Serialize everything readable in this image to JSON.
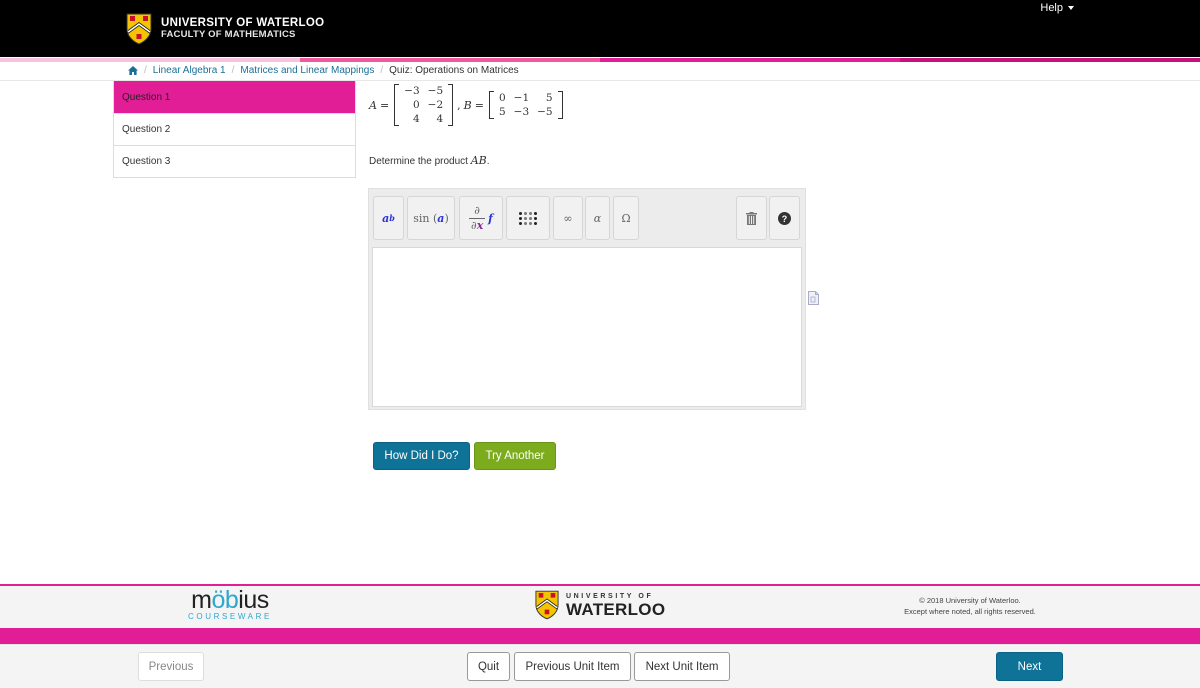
{
  "header": {
    "university": "UNIVERSITY OF WATERLOO",
    "faculty": "FACULTY OF MATHEMATICS",
    "help_label": "Help",
    "stripe_colors": [
      "#f9c3e0",
      "#f3589f",
      "#e21e97",
      "#c4127e"
    ]
  },
  "breadcrumb": {
    "home_icon": "home-icon",
    "items": [
      "Linear Algebra 1",
      "Matrices and Linear Mappings"
    ],
    "current": "Quiz: Operations on Matrices"
  },
  "sidebar": {
    "items": [
      {
        "label": "Question 1",
        "active": true
      },
      {
        "label": "Question 2",
        "active": false
      },
      {
        "label": "Question 3",
        "active": false
      }
    ]
  },
  "question": {
    "matrix_a_label": "A",
    "matrix_a": [
      [
        "−3",
        "−5"
      ],
      [
        "0",
        "−2"
      ],
      [
        "4",
        "4"
      ]
    ],
    "matrix_b_label": "B",
    "matrix_b": [
      [
        "0",
        "−1",
        "5"
      ],
      [
        "5",
        "−3",
        "−5"
      ]
    ],
    "equals": "=",
    "comma": ",",
    "prompt_text": "Determine the product ",
    "prompt_math": "AB",
    "prompt_end": "."
  },
  "editor": {
    "toolbar": {
      "power": {
        "base": "a",
        "exp": "b"
      },
      "sin": {
        "fn": "sin",
        "arg": "a"
      },
      "derivative": {
        "num": "∂",
        "den_d": "∂",
        "den_x": "x",
        "f": "f"
      },
      "infinity": "∞",
      "alpha": "α",
      "omega": "Ω"
    },
    "value": ""
  },
  "actions": {
    "check_label": "How Did I Do?",
    "another_label": "Try Another",
    "check_color": "#0f7398",
    "another_color": "#7cab1e"
  },
  "footer": {
    "mobius_main": "möbius",
    "mobius_sub": "COURSEWARE",
    "uw_small": "UNIVERSITY OF",
    "uw_big": "WATERLOO",
    "copyright_line1": "© 2018 University of Waterloo.",
    "copyright_line2": "Except where noted, all rights reserved."
  },
  "navigation": {
    "previous_label": "Previous",
    "quit_label": "Quit",
    "previous_unit_label": "Previous Unit Item",
    "next_unit_label": "Next Unit Item",
    "next_label": "Next",
    "accent_color": "#e21e97"
  }
}
